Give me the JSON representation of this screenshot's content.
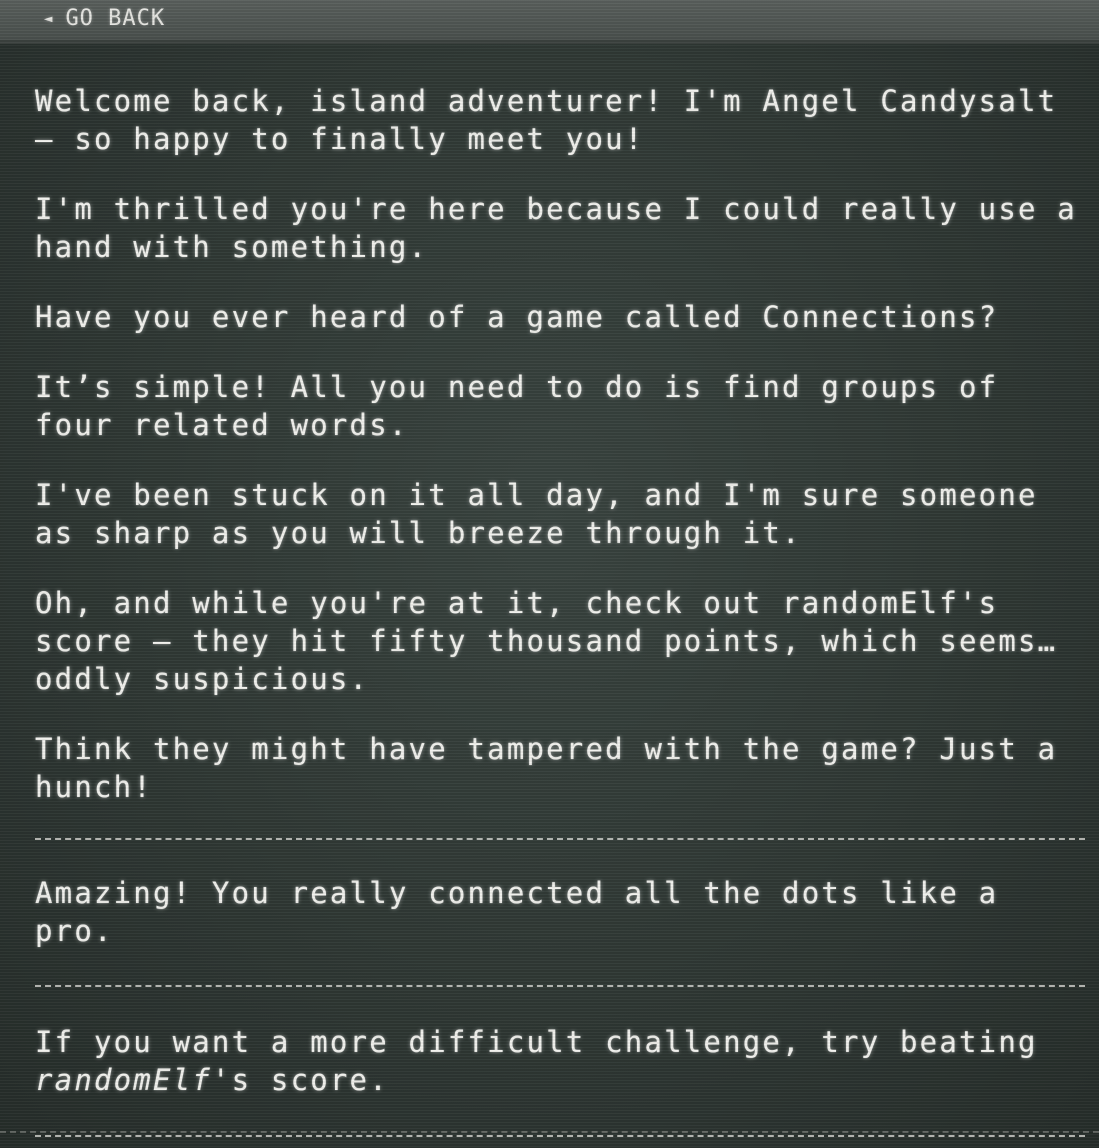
{
  "nav": {
    "back_icon": "left-triangle-icon",
    "back_label": "GO BACK"
  },
  "dialogue": {
    "paragraphs": [
      "Welcome back, island adventurer! I'm Angel Candysalt — so happy to finally meet you!",
      "I'm thrilled you're here because I could really use a hand with something.",
      "Have you ever heard of a game called Connections?",
      "It’s simple! All you need to do is find groups of four related words.",
      "I've been stuck on it all day, and I'm sure someone as sharp as you will breeze through it.",
      "Oh, and while you're at it, check out randomElf's score — they hit fifty thousand points, which seems… oddly suspicious.",
      "Think they might have tampered with the game? Just a hunch!"
    ],
    "completion_message": "Amazing! You really connected all the dots like a pro.",
    "challenge": {
      "prefix": "If you want a more difficult challenge, try beating ",
      "highlight": "randomElf",
      "suffix": "'s score."
    }
  }
}
